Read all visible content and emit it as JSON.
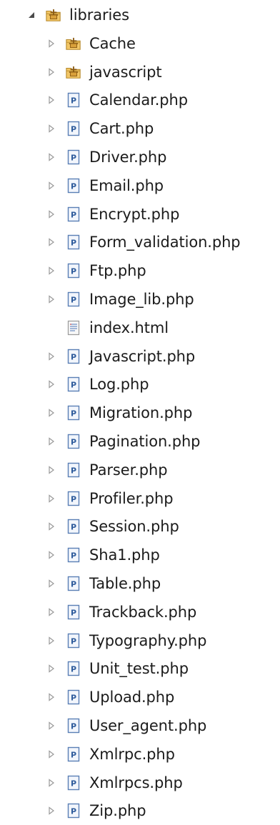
{
  "tree": {
    "root": {
      "label": "libraries",
      "icon": "package-folder-icon",
      "expanded": true
    },
    "children": [
      {
        "label": "Cache",
        "icon": "package-folder-icon",
        "expandable": true
      },
      {
        "label": "javascript",
        "icon": "package-folder-icon",
        "expandable": true
      },
      {
        "label": "Calendar.php",
        "icon": "php-file-icon",
        "expandable": true
      },
      {
        "label": "Cart.php",
        "icon": "php-file-icon",
        "expandable": true
      },
      {
        "label": "Driver.php",
        "icon": "php-file-icon",
        "expandable": true
      },
      {
        "label": "Email.php",
        "icon": "php-file-icon",
        "expandable": true
      },
      {
        "label": "Encrypt.php",
        "icon": "php-file-icon",
        "expandable": true
      },
      {
        "label": "Form_validation.php",
        "icon": "php-file-icon",
        "expandable": true
      },
      {
        "label": "Ftp.php",
        "icon": "php-file-icon",
        "expandable": true
      },
      {
        "label": "Image_lib.php",
        "icon": "php-file-icon",
        "expandable": true
      },
      {
        "label": "index.html",
        "icon": "html-file-icon",
        "expandable": false
      },
      {
        "label": "Javascript.php",
        "icon": "php-file-icon",
        "expandable": true
      },
      {
        "label": "Log.php",
        "icon": "php-file-icon",
        "expandable": true
      },
      {
        "label": "Migration.php",
        "icon": "php-file-icon",
        "expandable": true
      },
      {
        "label": "Pagination.php",
        "icon": "php-file-icon",
        "expandable": true
      },
      {
        "label": "Parser.php",
        "icon": "php-file-icon",
        "expandable": true
      },
      {
        "label": "Profiler.php",
        "icon": "php-file-icon",
        "expandable": true
      },
      {
        "label": "Session.php",
        "icon": "php-file-icon",
        "expandable": true
      },
      {
        "label": "Sha1.php",
        "icon": "php-file-icon",
        "expandable": true
      },
      {
        "label": "Table.php",
        "icon": "php-file-icon",
        "expandable": true
      },
      {
        "label": "Trackback.php",
        "icon": "php-file-icon",
        "expandable": true
      },
      {
        "label": "Typography.php",
        "icon": "php-file-icon",
        "expandable": true
      },
      {
        "label": "Unit_test.php",
        "icon": "php-file-icon",
        "expandable": true
      },
      {
        "label": "Upload.php",
        "icon": "php-file-icon",
        "expandable": true
      },
      {
        "label": "User_agent.php",
        "icon": "php-file-icon",
        "expandable": true
      },
      {
        "label": "Xmlrpc.php",
        "icon": "php-file-icon",
        "expandable": true
      },
      {
        "label": "Xmlrpcs.php",
        "icon": "php-file-icon",
        "expandable": true
      },
      {
        "label": "Zip.php",
        "icon": "php-file-icon",
        "expandable": true
      }
    ]
  },
  "colors": {
    "text": "#1b1b1b",
    "twisty_collapsed": "#9a9a9a",
    "twisty_expanded": "#4a4a4a",
    "folder_fill": "#f3c767",
    "folder_stroke": "#b5882a",
    "php_border": "#5a7fb5",
    "php_letter": "#2f5c9c"
  }
}
